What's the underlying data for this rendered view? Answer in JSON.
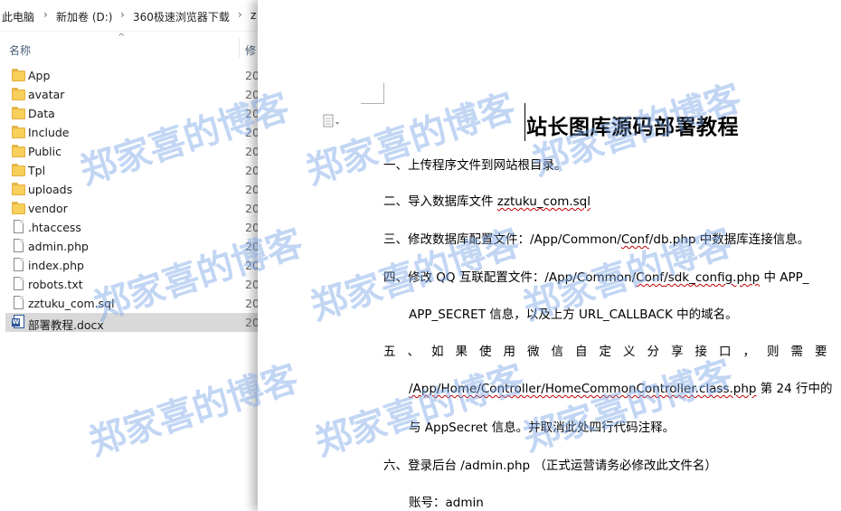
{
  "breadcrumb": {
    "items": [
      "此电脑",
      "新加卷 (D:)",
      "360极速浏览器下载",
      "z"
    ],
    "separator": "›"
  },
  "file_list": {
    "columns": {
      "name": "名称",
      "modified": "修"
    },
    "items": [
      {
        "name": "App",
        "type": "folder",
        "date": "20"
      },
      {
        "name": "avatar",
        "type": "folder",
        "date": "20"
      },
      {
        "name": "Data",
        "type": "folder",
        "date": "20"
      },
      {
        "name": "Include",
        "type": "folder",
        "date": "20"
      },
      {
        "name": "Public",
        "type": "folder",
        "date": "20"
      },
      {
        "name": "Tpl",
        "type": "folder",
        "date": "20"
      },
      {
        "name": "uploads",
        "type": "folder",
        "date": "20"
      },
      {
        "name": "vendor",
        "type": "folder",
        "date": "20"
      },
      {
        "name": ".htaccess",
        "type": "file",
        "date": "20"
      },
      {
        "name": "admin.php",
        "type": "file",
        "date": "20"
      },
      {
        "name": "index.php",
        "type": "file",
        "date": "20"
      },
      {
        "name": "robots.txt",
        "type": "file",
        "date": "20"
      },
      {
        "name": "zztuku_com.sql",
        "type": "file",
        "date": "20"
      },
      {
        "name": "部署教程.docx",
        "type": "docx",
        "date": "20",
        "selected": true
      }
    ]
  },
  "document": {
    "title": "站长图库源码部署教程",
    "step1": "一、上传程序文件到网站根目录。",
    "step2": {
      "prefix": "二、导入数据库文件",
      "file": "zztuku_com.sql"
    },
    "step3": {
      "prefix": "三、修改数据库配置文件：/App/Common/",
      "conf": "Conf",
      "path_rest": "/db.php",
      "suffix": " 中数据库连接信息。"
    },
    "step4": {
      "prefix": "四、修改 QQ 互联配置文件：/App/Common/",
      "conf": "Conf",
      "sdk": "/sdk_config.php",
      "suffix": " 中 APP_"
    },
    "step4_cont": "APP_SECRET 信息，以及上方 URL_CALLBACK 中的域名。",
    "step5": "五、如果使用微信自定义分享接口，则需要",
    "step5_path": "/App/Home/Controller/HomeCommonController.class.php",
    "step5_path_suffix": " 第 24 行中的",
    "step5_cont": "与 AppSecret 信息。并取消此处四行代码注释。",
    "step6": "六、登录后台 /admin.php （正式运营请务必修改此文件名）",
    "account": "账号：admin"
  },
  "watermark": {
    "text": "郑家喜的博客",
    "color": "#78a5e6"
  },
  "colors": {
    "selected_row": "#d9d9d9",
    "folder": "#f8cf5b",
    "docx": "#2b579a",
    "spellcheck": "#c00000"
  }
}
